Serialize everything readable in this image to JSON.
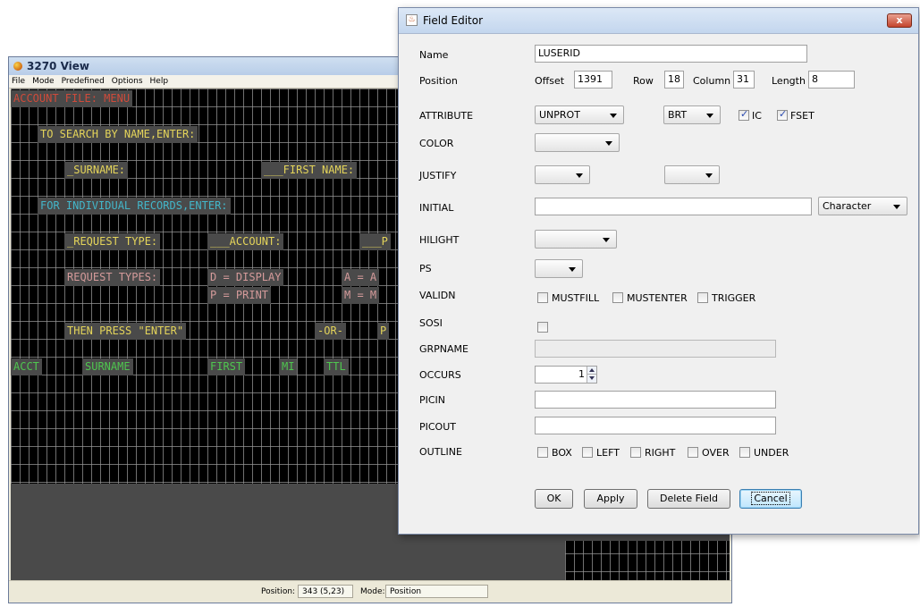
{
  "viewer": {
    "title": "3270 View",
    "menu": [
      "File",
      "Mode",
      "Predefined",
      "Options",
      "Help"
    ],
    "fields": [
      {
        "text": "ACCOUNT FILE: MENU",
        "color": "red",
        "row": 0,
        "col": 0
      },
      {
        "text": "TO SEARCH BY NAME,ENTER:",
        "color": "yellow",
        "row": 2,
        "col": 3
      },
      {
        "text": "_SURNAME:",
        "color": "yellow",
        "row": 4,
        "col": 6
      },
      {
        "text": "___FIRST NAME:",
        "color": "yellow",
        "row": 4,
        "col": 28
      },
      {
        "text": "FOR INDIVIDUAL RECORDS,ENTER:",
        "color": "cyan",
        "row": 6,
        "col": 3
      },
      {
        "text": "_REQUEST TYPE:",
        "color": "yellow",
        "row": 8,
        "col": 6
      },
      {
        "text": "___ACCOUNT:",
        "color": "yellow",
        "row": 8,
        "col": 22
      },
      {
        "text": "___P",
        "color": "yellow",
        "row": 8,
        "col": 39
      },
      {
        "text": "REQUEST TYPES:",
        "color": "pink",
        "row": 10,
        "col": 6
      },
      {
        "text": "D = DISPLAY",
        "color": "pink",
        "row": 10,
        "col": 22
      },
      {
        "text": "A = A",
        "color": "pink",
        "row": 10,
        "col": 37
      },
      {
        "text": "P = PRINT",
        "color": "pink",
        "row": 11,
        "col": 22
      },
      {
        "text": "M = M",
        "color": "pink",
        "row": 11,
        "col": 37
      },
      {
        "text": "THEN PRESS \"ENTER\"",
        "color": "yellow",
        "row": 13,
        "col": 6
      },
      {
        "text": "-OR-",
        "color": "yellow",
        "row": 13,
        "col": 34
      },
      {
        "text": "P",
        "color": "yellow",
        "row": 13,
        "col": 41
      },
      {
        "text": "ACCT",
        "color": "green",
        "row": 15,
        "col": 0
      },
      {
        "text": "SURNAME",
        "color": "green",
        "row": 15,
        "col": 8
      },
      {
        "text": "FIRST",
        "color": "green",
        "row": 15,
        "col": 22
      },
      {
        "text": "MI",
        "color": "green",
        "row": 15,
        "col": 30
      },
      {
        "text": "TTL",
        "color": "green",
        "row": 15,
        "col": 35
      }
    ],
    "status": {
      "position_label": "Position:",
      "position_value": "343 (5,23)",
      "mode_label": "Mode:",
      "mode_value": "Position"
    }
  },
  "dialog": {
    "title": "Field Editor",
    "name_label": "Name",
    "name_value": "LUSERID",
    "position_label": "Position",
    "offset_label": "Offset",
    "offset_value": "1391",
    "row_label": "Row",
    "row_value": "18",
    "column_label": "Column",
    "column_value": "31",
    "length_label": "Length",
    "length_value": "8",
    "attribute_label": "ATTRIBUTE",
    "attribute_value": "UNPROT",
    "intensity_value": "BRT",
    "ic_label": "IC",
    "fset_label": "FSET",
    "color_label": "COLOR",
    "justify_label": "JUSTIFY",
    "initial_label": "INITIAL",
    "initial_type": "Character",
    "hilight_label": "HILIGHT",
    "ps_label": "PS",
    "validn_label": "VALIDN",
    "mustfill_label": "MUSTFILL",
    "mustenter_label": "MUSTENTER",
    "trigger_label": "TRIGGER",
    "sosi_label": "SOSI",
    "grpname_label": "GRPNAME",
    "occurs_label": "OCCURS",
    "occurs_value": "1",
    "picin_label": "PICIN",
    "picout_label": "PICOUT",
    "outline_label": "OUTLINE",
    "box_label": "BOX",
    "left_label": "LEFT",
    "right_label": "RIGHT",
    "over_label": "OVER",
    "under_label": "UNDER",
    "ok_label": "OK",
    "apply_label": "Apply",
    "delete_label": "Delete Field",
    "cancel_label": "Cancel",
    "close_glyph": "x"
  }
}
